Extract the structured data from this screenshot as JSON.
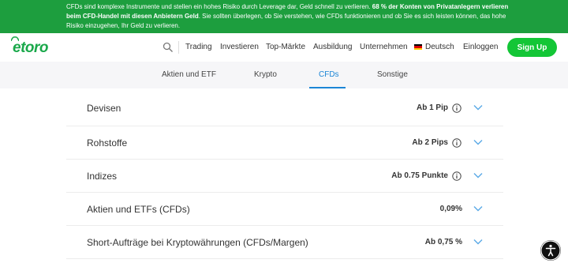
{
  "banner": {
    "text_normal_1": "CFDs sind komplexe Instrumente und stellen ein hohes Risiko durch Leverage dar, Geld schnell zu verlieren. ",
    "text_bold": "68 % der Konten von Privatanlegern verlieren beim CFD-Handel mit diesen Anbietern Geld",
    "text_normal_2": ". Sie sollten überlegen, ob Sie verstehen, wie CFDs funktionieren und ob Sie es sich leisten können, das hohe Risiko einzugehen, Ihr Geld zu verlieren."
  },
  "header": {
    "logo": "etoro",
    "nav": [
      "Trading",
      "Investieren",
      "Top-Märkte",
      "Ausbildung",
      "Unternehmen"
    ],
    "language": "Deutsch",
    "login": "Einloggen",
    "signup": "Sign Up"
  },
  "tabs": {
    "items": [
      "Aktien und ETF",
      "Krypto",
      "CFDs",
      "Sonstige"
    ],
    "active": "CFDs"
  },
  "fees": {
    "rows": [
      {
        "label": "Devisen",
        "value": "Ab 1 Pip"
      },
      {
        "label": "Rohstoffe",
        "value": "Ab 2 Pips"
      },
      {
        "label": "Indizes",
        "value": "Ab 0.75 Punkte"
      },
      {
        "label": "Aktien und ETFs (CFDs)",
        "value": "0,09%"
      },
      {
        "label": "Short-Aufträge bei Kryptowährungen (CFDs/Margen)",
        "value": "Ab 0,75 %"
      }
    ]
  },
  "colors": {
    "banner_green": "#1d9e3e",
    "brand_green": "#19a84a",
    "signup_green": "#13c636",
    "active_tab_blue": "#1b86d6",
    "chevron_blue": "#5aa9e6"
  }
}
